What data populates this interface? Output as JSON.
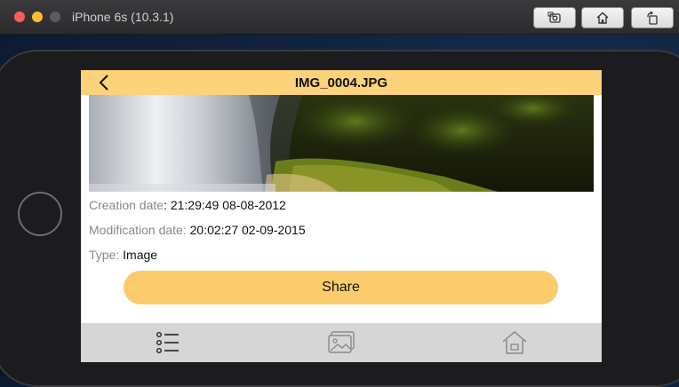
{
  "simulator": {
    "title": "iPhone 6s (10.3.1)",
    "toolbar": [
      {
        "icon": "screenshot-camera-icon"
      },
      {
        "icon": "home-icon"
      },
      {
        "icon": "rotate-icon"
      }
    ]
  },
  "app": {
    "nav": {
      "title": "IMG_0004.JPG",
      "back_icon": "chevron-left-icon",
      "bar_color": "#fcd27a"
    },
    "details": {
      "creation_label": "Creation date",
      "creation_value": ": 21:29:49 08-08-2012",
      "modification_label": "Modification date:",
      "modification_value": " 20:02:27 02-09-2015",
      "type_label": "Type:",
      "type_value": " Image"
    },
    "share_label": "Share",
    "share_color": "#fccb6c",
    "tabs": [
      {
        "icon": "list-icon",
        "active": true
      },
      {
        "icon": "photos-icon",
        "active": false
      },
      {
        "icon": "home-icon",
        "active": false
      }
    ]
  }
}
